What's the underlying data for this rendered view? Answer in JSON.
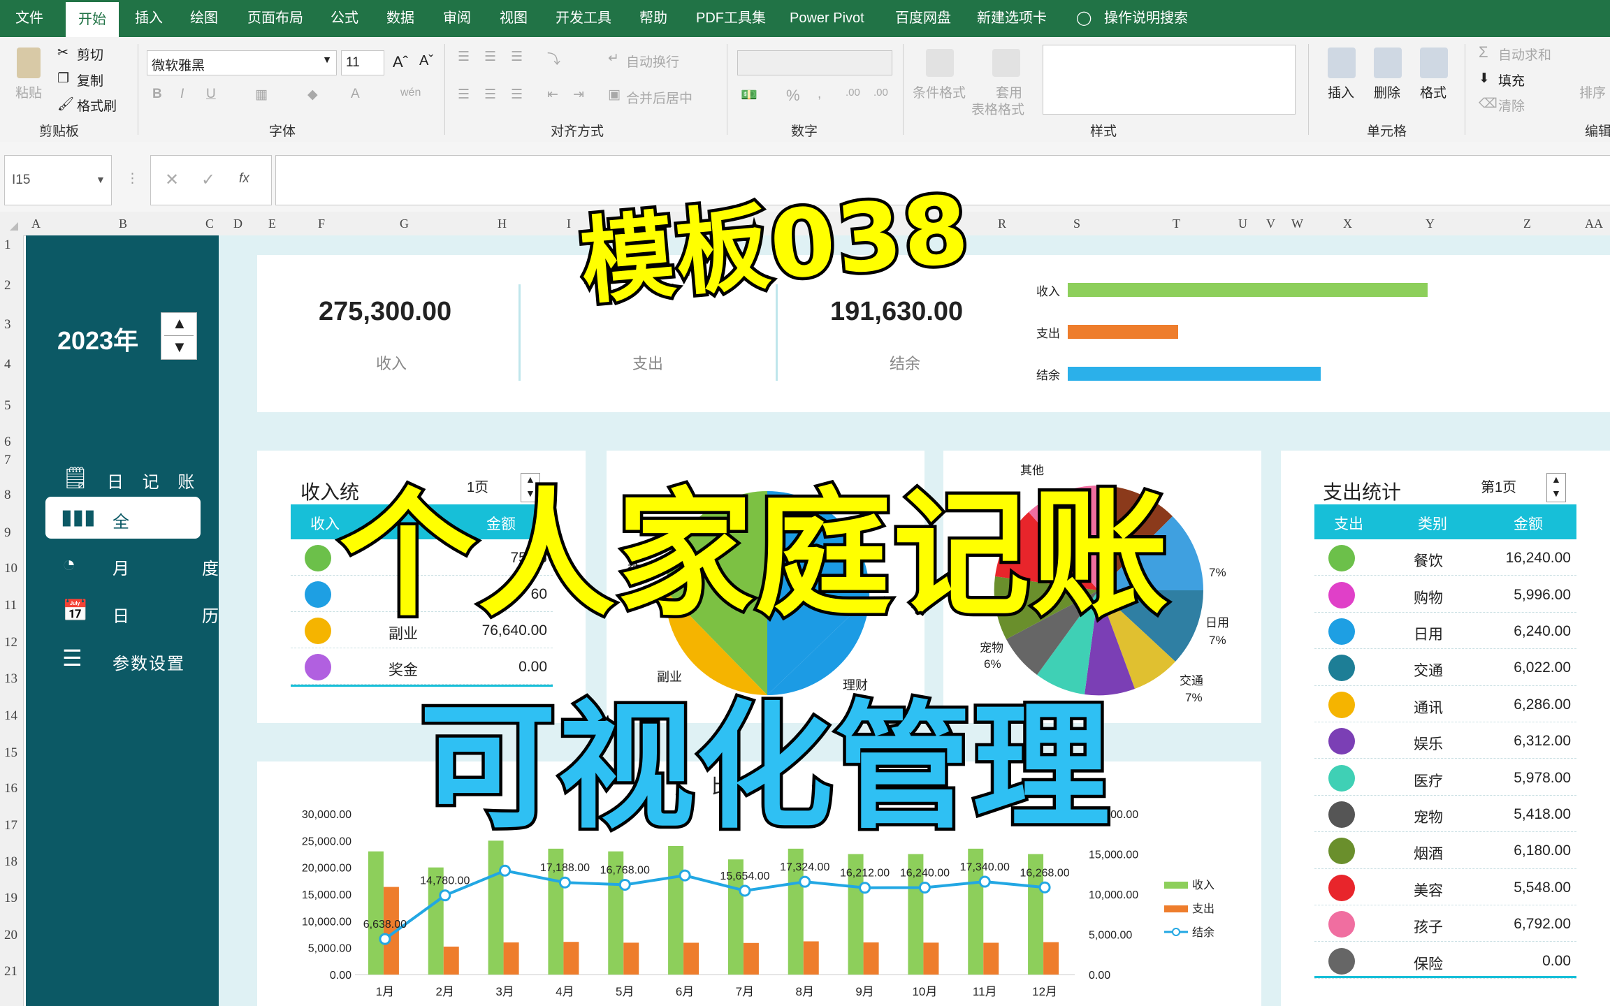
{
  "ribbon_tabs": [
    "文件",
    "开始",
    "插入",
    "绘图",
    "页面布局",
    "公式",
    "数据",
    "审阅",
    "视图",
    "开发工具",
    "帮助",
    "PDF工具集",
    "Power Pivot",
    "百度网盘",
    "新建选项卡",
    "操作说明搜索"
  ],
  "clipboard": {
    "paste": "粘贴",
    "cut": "剪切",
    "copy": "复制",
    "format_painter": "格式刷",
    "group": "剪贴板"
  },
  "font": {
    "name": "微软雅黑",
    "size": "11",
    "group": "字体"
  },
  "align": {
    "wrap": "自动换行",
    "merge": "合并后居中",
    "group": "对齐方式"
  },
  "number": {
    "group": "数字"
  },
  "styles": {
    "cond": "条件格式",
    "table1": "套用",
    "table2": "表格格式",
    "group": "样式"
  },
  "cells": {
    "insert": "插入",
    "delete": "删除",
    "format": "格式",
    "group": "单元格"
  },
  "editing": {
    "autosum": "自动求和",
    "fill": "填充",
    "clear": "清除",
    "sort": "排序",
    "group": "编辑"
  },
  "name_box": "I15",
  "fx": "fx",
  "col_headers": [
    "A",
    "B",
    "C",
    "D",
    "E",
    "F",
    "G",
    "H",
    "I",
    "J",
    "K",
    "L",
    "R",
    "S",
    "T",
    "U",
    "V",
    "W",
    "X",
    "Y",
    "Z",
    "AA"
  ],
  "row_headers": [
    "1",
    "2",
    "3",
    "4",
    "5",
    "6",
    "7",
    "8",
    "9",
    "10",
    "11",
    "12",
    "13",
    "14",
    "15",
    "16",
    "17",
    "18",
    "19",
    "20",
    "21"
  ],
  "sidebar": {
    "year": "2023年",
    "nav": [
      "日 记 账",
      "全　年",
      "月　度",
      "日　历",
      "参数设置"
    ]
  },
  "summary": {
    "income_value": "275,300.00",
    "income_label": "收入",
    "expense_label": "支出",
    "balance_value": "191,630.00",
    "balance_label": "结余",
    "bars": [
      {
        "label": "收入",
        "value": 275300,
        "color": "#8dcf5b"
      },
      {
        "label": "支出",
        "value": 83670,
        "color": "#ee7d2c"
      },
      {
        "label": "结余",
        "value": 191630,
        "color": "#2bb0ea"
      }
    ]
  },
  "income_table": {
    "title": "收入统",
    "page": "1页",
    "headers": [
      "收入",
      "金额"
    ],
    "rows": [
      {
        "cat": "",
        "amount": "75,06",
        "color": "#6cc04a"
      },
      {
        "cat": "",
        "amount": "60",
        "color": "#1e9fe3"
      },
      {
        "cat": "副业",
        "amount": "76,640.00",
        "color": "#f5b400"
      },
      {
        "cat": "奖金",
        "amount": "0.00",
        "color": "#b160e0"
      }
    ]
  },
  "pie_labels": {
    "left": [
      "基",
      "副业",
      "理财"
    ],
    "right": [
      "日用",
      "7%",
      "交通",
      "7%",
      "宠物",
      "6%",
      "8%",
      "7%",
      "7%",
      "7%",
      "其他"
    ]
  },
  "expense_table": {
    "title": "支出统计",
    "page": "第1页",
    "headers": [
      "支出",
      "类别",
      "金额"
    ],
    "rows": [
      {
        "cat": "餐饮",
        "amount": "16,240.00",
        "color": "#6cc04a"
      },
      {
        "cat": "购物",
        "amount": "5,996.00",
        "color": "#e040c8"
      },
      {
        "cat": "日用",
        "amount": "6,240.00",
        "color": "#1e9fe3"
      },
      {
        "cat": "交通",
        "amount": "6,022.00",
        "color": "#1d7e96"
      },
      {
        "cat": "通讯",
        "amount": "6,286.00",
        "color": "#f5b400"
      },
      {
        "cat": "娱乐",
        "amount": "6,312.00",
        "color": "#7b3fb5"
      },
      {
        "cat": "医疗",
        "amount": "5,978.00",
        "color": "#3fd0b5"
      },
      {
        "cat": "宠物",
        "amount": "5,418.00",
        "color": "#555555"
      },
      {
        "cat": "烟酒",
        "amount": "6,180.00",
        "color": "#6a8f2c"
      },
      {
        "cat": "美容",
        "amount": "5,548.00",
        "color": "#e8252b"
      },
      {
        "cat": "孩子",
        "amount": "6,792.00",
        "color": "#f06ea0"
      },
      {
        "cat": "保险",
        "amount": "0.00",
        "color": "#666666"
      }
    ]
  },
  "chart_data": {
    "type": "bar",
    "title_fragment": "比",
    "categories": [
      "1月",
      "2月",
      "3月",
      "4月",
      "5月",
      "6月",
      "7月",
      "8月",
      "9月",
      "10月",
      "11月",
      "12月"
    ],
    "series": [
      {
        "name": "收入",
        "type": "bar",
        "values": [
          23000,
          20000,
          25000,
          23500,
          23000,
          24000,
          21500,
          23500,
          22500,
          22500,
          23500,
          22500
        ]
      },
      {
        "name": "支出",
        "type": "bar",
        "values": [
          16362,
          5220,
          6000,
          6100,
          5950,
          5940,
          5900,
          6200,
          6000,
          5960,
          5940,
          6050
        ]
      },
      {
        "name": "结余",
        "type": "line",
        "values": [
          6638,
          14780,
          19400,
          17188,
          16768,
          18500,
          15654,
          17324,
          16212,
          16240,
          17340,
          16268
        ]
      }
    ],
    "point_labels": [
      "6,638.00",
      "14,780.00",
      "",
      "17,188.00",
      "16,768.00",
      "",
      "15,654.00",
      "17,324.00",
      "16,212.00",
      "16,240.00",
      "17,340.00",
      "16,268.00"
    ],
    "y_left_ticks": [
      "30,000.00",
      "25,000.00",
      "20,000.00",
      "15,000.00",
      "10,000.00",
      "5,000.00",
      "0.00"
    ],
    "y_right_ticks": [
      "20,000.00",
      "15,000.00",
      "10,000.00",
      "5,000.00",
      "0.00"
    ],
    "ylim": [
      0,
      30000
    ],
    "legend": [
      "收入",
      "支出",
      "结余"
    ]
  },
  "overlay": {
    "title1": "模板038",
    "title2": "个人家庭记账",
    "title3": "可视化管理"
  }
}
